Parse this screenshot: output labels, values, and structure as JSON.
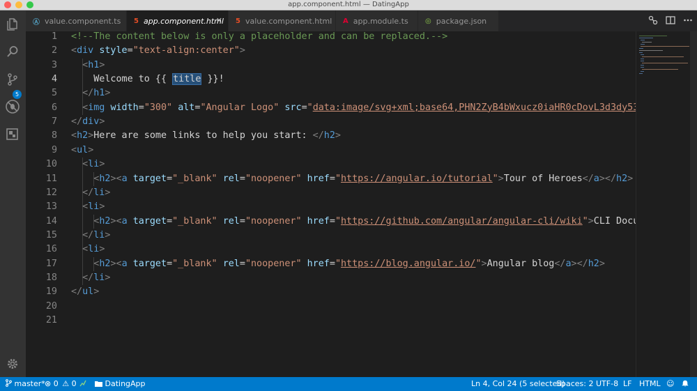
{
  "window": {
    "title": "app.component.html — DatingApp"
  },
  "activity_bar": {
    "source_control_badge": "5"
  },
  "tabs": [
    {
      "label": "value.component.ts",
      "icon": "typescript-icon",
      "icon_glyph": "Ⓐ",
      "icon_color": "#519aba",
      "active": false
    },
    {
      "label": "app.component.html",
      "icon": "html5-icon",
      "icon_glyph": "5",
      "icon_color": "#e44d26",
      "active": true,
      "close_glyph": "✕"
    },
    {
      "label": "value.component.html",
      "icon": "html5-icon",
      "icon_glyph": "5",
      "icon_color": "#e44d26",
      "active": false
    },
    {
      "label": "app.module.ts",
      "icon": "angular-icon",
      "icon_glyph": "A",
      "icon_color": "#dd0031",
      "active": false
    },
    {
      "label": "package.json",
      "icon": "npm-icon",
      "icon_glyph": "◎",
      "icon_color": "#8bc34a",
      "active": false
    }
  ],
  "editor": {
    "cursor_line": 4,
    "lines": [
      [
        [
          "cmt",
          "<!--The content below is only a placeholder and can be replaced.-->"
        ]
      ],
      [
        [
          "brk",
          "<"
        ],
        [
          "tag",
          "div"
        ],
        [
          "txt",
          " "
        ],
        [
          "attr",
          "style"
        ],
        [
          "txt",
          "="
        ],
        [
          "str",
          "\"text-align:center\""
        ],
        [
          "brk",
          ">"
        ]
      ],
      [
        [
          "txt",
          "  "
        ],
        [
          "brk",
          "<"
        ],
        [
          "tag",
          "h1"
        ],
        [
          "brk",
          ">"
        ]
      ],
      [
        [
          "txt",
          "    Welcome to {{ "
        ],
        [
          "sel",
          "title"
        ],
        [
          "txt",
          " }}!"
        ]
      ],
      [
        [
          "txt",
          "  "
        ],
        [
          "brk",
          "</"
        ],
        [
          "tag",
          "h1"
        ],
        [
          "brk",
          ">"
        ]
      ],
      [
        [
          "txt",
          "  "
        ],
        [
          "brk",
          "<"
        ],
        [
          "tag",
          "img"
        ],
        [
          "txt",
          " "
        ],
        [
          "attr",
          "width"
        ],
        [
          "txt",
          "="
        ],
        [
          "str",
          "\"300\""
        ],
        [
          "txt",
          " "
        ],
        [
          "attr",
          "alt"
        ],
        [
          "txt",
          "="
        ],
        [
          "str",
          "\"Angular Logo\""
        ],
        [
          "txt",
          " "
        ],
        [
          "attr",
          "src"
        ],
        [
          "txt",
          "="
        ],
        [
          "str",
          "\""
        ],
        [
          "url",
          "data:image/svg+xml;base64,PHN2ZyB4bWxucz0iaHR0cDovL3d3dy53M"
        ]
      ],
      [
        [
          "brk",
          "</"
        ],
        [
          "tag",
          "div"
        ],
        [
          "brk",
          ">"
        ]
      ],
      [
        [
          "brk",
          "<"
        ],
        [
          "tag",
          "h2"
        ],
        [
          "brk",
          ">"
        ],
        [
          "txt",
          "Here are some links to help you start: "
        ],
        [
          "brk",
          "</"
        ],
        [
          "tag",
          "h2"
        ],
        [
          "brk",
          ">"
        ]
      ],
      [
        [
          "brk",
          "<"
        ],
        [
          "tag",
          "ul"
        ],
        [
          "brk",
          ">"
        ]
      ],
      [
        [
          "txt",
          "  "
        ],
        [
          "brk",
          "<"
        ],
        [
          "tag",
          "li"
        ],
        [
          "brk",
          ">"
        ]
      ],
      [
        [
          "txt",
          "    "
        ],
        [
          "brk",
          "<"
        ],
        [
          "tag",
          "h2"
        ],
        [
          "brk",
          "><"
        ],
        [
          "tag",
          "a"
        ],
        [
          "txt",
          " "
        ],
        [
          "attr",
          "target"
        ],
        [
          "txt",
          "="
        ],
        [
          "str",
          "\"_blank\""
        ],
        [
          "txt",
          " "
        ],
        [
          "attr",
          "rel"
        ],
        [
          "txt",
          "="
        ],
        [
          "str",
          "\"noopener\""
        ],
        [
          "txt",
          " "
        ],
        [
          "attr",
          "href"
        ],
        [
          "txt",
          "="
        ],
        [
          "str",
          "\""
        ],
        [
          "url",
          "https://angular.io/tutorial"
        ],
        [
          "str",
          "\""
        ],
        [
          "brk",
          ">"
        ],
        [
          "txt",
          "Tour of Heroes"
        ],
        [
          "brk",
          "</"
        ],
        [
          "tag",
          "a"
        ],
        [
          "brk",
          "></"
        ],
        [
          "tag",
          "h2"
        ],
        [
          "brk",
          ">"
        ]
      ],
      [
        [
          "txt",
          "  "
        ],
        [
          "brk",
          "</"
        ],
        [
          "tag",
          "li"
        ],
        [
          "brk",
          ">"
        ]
      ],
      [
        [
          "txt",
          "  "
        ],
        [
          "brk",
          "<"
        ],
        [
          "tag",
          "li"
        ],
        [
          "brk",
          ">"
        ]
      ],
      [
        [
          "txt",
          "    "
        ],
        [
          "brk",
          "<"
        ],
        [
          "tag",
          "h2"
        ],
        [
          "brk",
          "><"
        ],
        [
          "tag",
          "a"
        ],
        [
          "txt",
          " "
        ],
        [
          "attr",
          "target"
        ],
        [
          "txt",
          "="
        ],
        [
          "str",
          "\"_blank\""
        ],
        [
          "txt",
          " "
        ],
        [
          "attr",
          "rel"
        ],
        [
          "txt",
          "="
        ],
        [
          "str",
          "\"noopener\""
        ],
        [
          "txt",
          " "
        ],
        [
          "attr",
          "href"
        ],
        [
          "txt",
          "="
        ],
        [
          "str",
          "\""
        ],
        [
          "url",
          "https://github.com/angular/angular-cli/wiki"
        ],
        [
          "str",
          "\""
        ],
        [
          "brk",
          ">"
        ],
        [
          "txt",
          "CLI Docu"
        ]
      ],
      [
        [
          "txt",
          "  "
        ],
        [
          "brk",
          "</"
        ],
        [
          "tag",
          "li"
        ],
        [
          "brk",
          ">"
        ]
      ],
      [
        [
          "txt",
          "  "
        ],
        [
          "brk",
          "<"
        ],
        [
          "tag",
          "li"
        ],
        [
          "brk",
          ">"
        ]
      ],
      [
        [
          "txt",
          "    "
        ],
        [
          "brk",
          "<"
        ],
        [
          "tag",
          "h2"
        ],
        [
          "brk",
          "><"
        ],
        [
          "tag",
          "a"
        ],
        [
          "txt",
          " "
        ],
        [
          "attr",
          "target"
        ],
        [
          "txt",
          "="
        ],
        [
          "str",
          "\"_blank\""
        ],
        [
          "txt",
          " "
        ],
        [
          "attr",
          "rel"
        ],
        [
          "txt",
          "="
        ],
        [
          "str",
          "\"noopener\""
        ],
        [
          "txt",
          " "
        ],
        [
          "attr",
          "href"
        ],
        [
          "txt",
          "="
        ],
        [
          "str",
          "\""
        ],
        [
          "url",
          "https://blog.angular.io/"
        ],
        [
          "str",
          "\""
        ],
        [
          "brk",
          ">"
        ],
        [
          "txt",
          "Angular blog"
        ],
        [
          "brk",
          "</"
        ],
        [
          "tag",
          "a"
        ],
        [
          "brk",
          "></"
        ],
        [
          "tag",
          "h2"
        ],
        [
          "brk",
          ">"
        ]
      ],
      [
        [
          "txt",
          "  "
        ],
        [
          "brk",
          "</"
        ],
        [
          "tag",
          "li"
        ],
        [
          "brk",
          ">"
        ]
      ],
      [
        [
          "brk",
          "</"
        ],
        [
          "tag",
          "ul"
        ],
        [
          "brk",
          ">"
        ]
      ],
      [],
      []
    ]
  },
  "status_bar": {
    "branch": "master*",
    "errors": "0",
    "warnings": "0",
    "folder": "DatingApp",
    "position": "Ln 4, Col 24 (5 selected)",
    "spaces": "Spaces: 2",
    "encoding": "UTF-8",
    "eol": "LF",
    "language": "HTML"
  },
  "colors": {
    "accent": "#007acc",
    "editor_bg": "#1e1e1e",
    "activity_bg": "#333333"
  }
}
